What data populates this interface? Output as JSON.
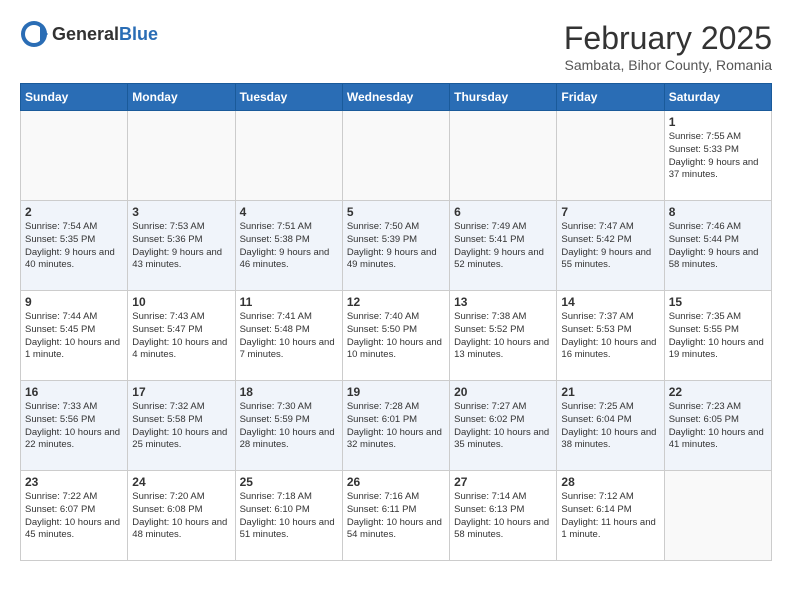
{
  "header": {
    "logo_general": "General",
    "logo_blue": "Blue",
    "month_title": "February 2025",
    "location": "Sambata, Bihor County, Romania"
  },
  "weekdays": [
    "Sunday",
    "Monday",
    "Tuesday",
    "Wednesday",
    "Thursday",
    "Friday",
    "Saturday"
  ],
  "weeks": [
    [
      {
        "day": "",
        "info": ""
      },
      {
        "day": "",
        "info": ""
      },
      {
        "day": "",
        "info": ""
      },
      {
        "day": "",
        "info": ""
      },
      {
        "day": "",
        "info": ""
      },
      {
        "day": "",
        "info": ""
      },
      {
        "day": "1",
        "info": "Sunrise: 7:55 AM\nSunset: 5:33 PM\nDaylight: 9 hours and 37 minutes."
      }
    ],
    [
      {
        "day": "2",
        "info": "Sunrise: 7:54 AM\nSunset: 5:35 PM\nDaylight: 9 hours and 40 minutes."
      },
      {
        "day": "3",
        "info": "Sunrise: 7:53 AM\nSunset: 5:36 PM\nDaylight: 9 hours and 43 minutes."
      },
      {
        "day": "4",
        "info": "Sunrise: 7:51 AM\nSunset: 5:38 PM\nDaylight: 9 hours and 46 minutes."
      },
      {
        "day": "5",
        "info": "Sunrise: 7:50 AM\nSunset: 5:39 PM\nDaylight: 9 hours and 49 minutes."
      },
      {
        "day": "6",
        "info": "Sunrise: 7:49 AM\nSunset: 5:41 PM\nDaylight: 9 hours and 52 minutes."
      },
      {
        "day": "7",
        "info": "Sunrise: 7:47 AM\nSunset: 5:42 PM\nDaylight: 9 hours and 55 minutes."
      },
      {
        "day": "8",
        "info": "Sunrise: 7:46 AM\nSunset: 5:44 PM\nDaylight: 9 hours and 58 minutes."
      }
    ],
    [
      {
        "day": "9",
        "info": "Sunrise: 7:44 AM\nSunset: 5:45 PM\nDaylight: 10 hours and 1 minute."
      },
      {
        "day": "10",
        "info": "Sunrise: 7:43 AM\nSunset: 5:47 PM\nDaylight: 10 hours and 4 minutes."
      },
      {
        "day": "11",
        "info": "Sunrise: 7:41 AM\nSunset: 5:48 PM\nDaylight: 10 hours and 7 minutes."
      },
      {
        "day": "12",
        "info": "Sunrise: 7:40 AM\nSunset: 5:50 PM\nDaylight: 10 hours and 10 minutes."
      },
      {
        "day": "13",
        "info": "Sunrise: 7:38 AM\nSunset: 5:52 PM\nDaylight: 10 hours and 13 minutes."
      },
      {
        "day": "14",
        "info": "Sunrise: 7:37 AM\nSunset: 5:53 PM\nDaylight: 10 hours and 16 minutes."
      },
      {
        "day": "15",
        "info": "Sunrise: 7:35 AM\nSunset: 5:55 PM\nDaylight: 10 hours and 19 minutes."
      }
    ],
    [
      {
        "day": "16",
        "info": "Sunrise: 7:33 AM\nSunset: 5:56 PM\nDaylight: 10 hours and 22 minutes."
      },
      {
        "day": "17",
        "info": "Sunrise: 7:32 AM\nSunset: 5:58 PM\nDaylight: 10 hours and 25 minutes."
      },
      {
        "day": "18",
        "info": "Sunrise: 7:30 AM\nSunset: 5:59 PM\nDaylight: 10 hours and 28 minutes."
      },
      {
        "day": "19",
        "info": "Sunrise: 7:28 AM\nSunset: 6:01 PM\nDaylight: 10 hours and 32 minutes."
      },
      {
        "day": "20",
        "info": "Sunrise: 7:27 AM\nSunset: 6:02 PM\nDaylight: 10 hours and 35 minutes."
      },
      {
        "day": "21",
        "info": "Sunrise: 7:25 AM\nSunset: 6:04 PM\nDaylight: 10 hours and 38 minutes."
      },
      {
        "day": "22",
        "info": "Sunrise: 7:23 AM\nSunset: 6:05 PM\nDaylight: 10 hours and 41 minutes."
      }
    ],
    [
      {
        "day": "23",
        "info": "Sunrise: 7:22 AM\nSunset: 6:07 PM\nDaylight: 10 hours and 45 minutes."
      },
      {
        "day": "24",
        "info": "Sunrise: 7:20 AM\nSunset: 6:08 PM\nDaylight: 10 hours and 48 minutes."
      },
      {
        "day": "25",
        "info": "Sunrise: 7:18 AM\nSunset: 6:10 PM\nDaylight: 10 hours and 51 minutes."
      },
      {
        "day": "26",
        "info": "Sunrise: 7:16 AM\nSunset: 6:11 PM\nDaylight: 10 hours and 54 minutes."
      },
      {
        "day": "27",
        "info": "Sunrise: 7:14 AM\nSunset: 6:13 PM\nDaylight: 10 hours and 58 minutes."
      },
      {
        "day": "28",
        "info": "Sunrise: 7:12 AM\nSunset: 6:14 PM\nDaylight: 11 hours and 1 minute."
      },
      {
        "day": "",
        "info": ""
      }
    ]
  ]
}
